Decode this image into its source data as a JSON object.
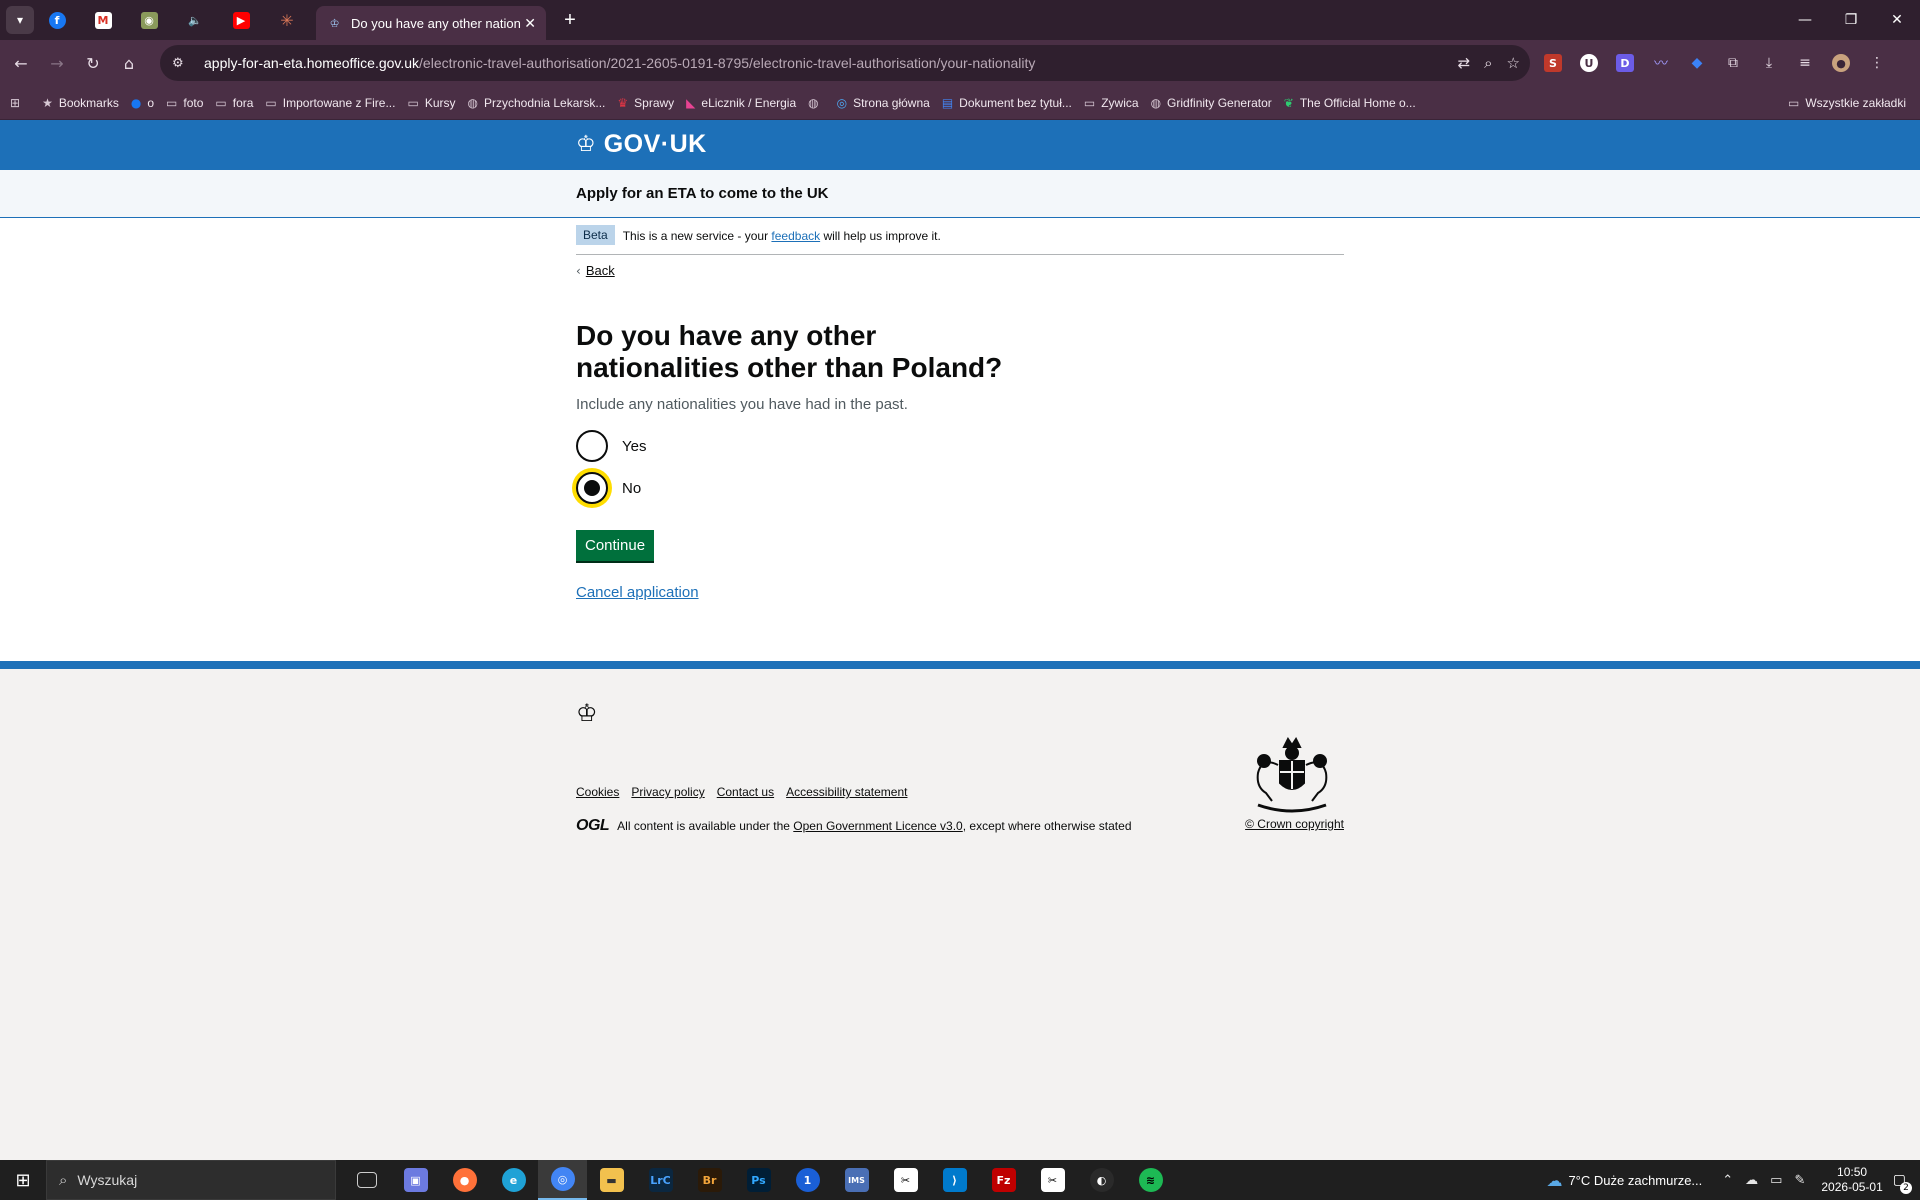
{
  "browser": {
    "active_tab_title": "Do you have any other nationalities other than Poland?",
    "url_host": "apply-for-an-eta.homeoffice.gov.uk",
    "url_path": "/electronic-travel-authorisation/2021-2605-0191-8795/electronic-travel-authorisation/your-nationality",
    "bookmarks": [
      {
        "label": "Bookmarks",
        "icon": "star-icon"
      },
      {
        "label": "o",
        "icon": "facebook-icon"
      },
      {
        "label": "foto",
        "icon": "folder-icon"
      },
      {
        "label": "fora",
        "icon": "folder-icon"
      },
      {
        "label": "Importowane z Fire...",
        "icon": "folder-icon"
      },
      {
        "label": "Kursy",
        "icon": "folder-icon"
      },
      {
        "label": "Przychodnia Lekarsk...",
        "icon": "globe-icon"
      },
      {
        "label": "Sprawy",
        "icon": "eagle-icon"
      },
      {
        "label": "eLicznik / Energia",
        "icon": "energy-icon"
      },
      {
        "label": "",
        "icon": "globe-icon"
      },
      {
        "label": "Strona główna",
        "icon": "target-icon"
      },
      {
        "label": "Dokument bez tytuł...",
        "icon": "doc-icon"
      },
      {
        "label": "Zywica",
        "icon": "folder-icon"
      },
      {
        "label": "Gridfinity Generator",
        "icon": "globe-icon"
      },
      {
        "label": "The Official Home o...",
        "icon": "leaf-icon"
      }
    ],
    "all_bookmarks": "Wszystkie zakładki"
  },
  "gov": {
    "logo_text": "GOV·UK",
    "service_name": "Apply for an ETA to come to the UK",
    "phase_tag": "Beta",
    "phase_text_before": "This is a new service - your",
    "phase_link": "feedback",
    "phase_text_after": "will help us improve it.",
    "back_label": "Back"
  },
  "question": {
    "heading": "Do you have any other nationalities other than Poland?",
    "hint": "Include any nationalities you have had in the past.",
    "options": [
      {
        "label": "Yes",
        "checked": false
      },
      {
        "label": "No",
        "checked": true
      }
    ],
    "continue_label": "Continue",
    "cancel_label": "Cancel application"
  },
  "footer": {
    "links": [
      "Cookies",
      "Privacy policy",
      "Contact us",
      "Accessibility statement"
    ],
    "ogl_logo": "OGL",
    "licence_before": "All content is available under the",
    "licence_link": "Open Government Licence v3.0",
    "licence_after": ", except where otherwise stated",
    "copyright": "© Crown copyright"
  },
  "taskbar": {
    "search_placeholder": "Wyszukaj",
    "weather": "7°C  Duże zachmurze...",
    "time": "10:50",
    "date": "2026-05-01",
    "notifications": "2"
  },
  "colors": {
    "gov_blue": "#1d70b8",
    "button_green": "#00703c",
    "focus_yellow": "#ffdd00",
    "browser_frame": "#4a2f45"
  }
}
